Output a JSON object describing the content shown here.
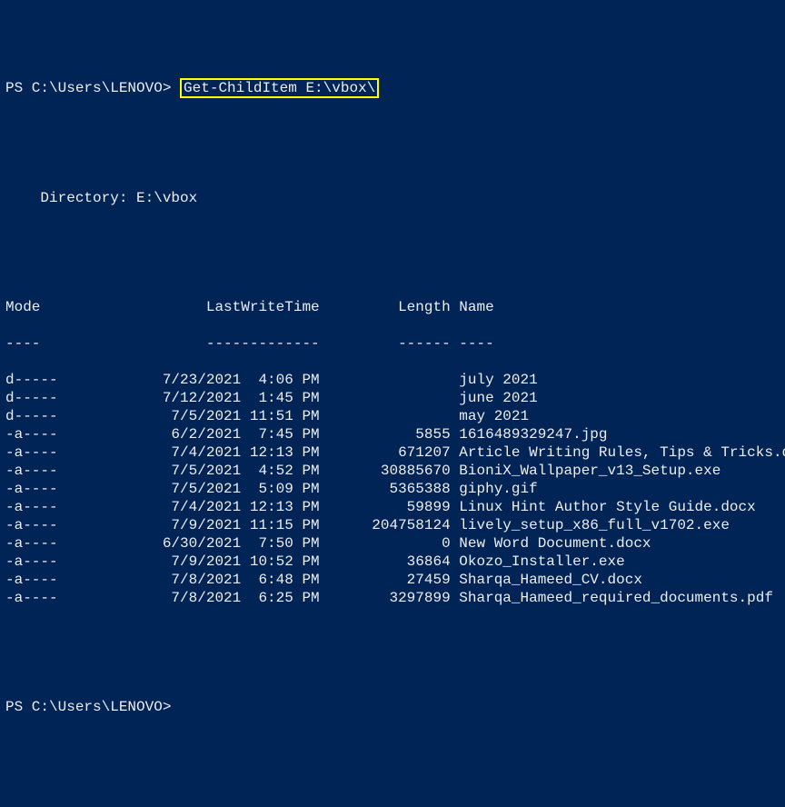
{
  "prompt1": {
    "prefix": "PS C:\\Users\\LENOVO> ",
    "command": "Get-ChildItem E:\\vbox\\"
  },
  "directory_label": "    Directory: E:\\vbox",
  "headers": {
    "mode": "Mode",
    "lwt": "LastWriteTime",
    "length": "Length",
    "name": "Name"
  },
  "underlines": {
    "mode": "----",
    "lwt": "-------------",
    "length": "------",
    "name": "----"
  },
  "rows": [
    {
      "mode": "d-----",
      "date": "7/23/2021",
      "time": "4:06 PM",
      "length": "",
      "name": "july 2021"
    },
    {
      "mode": "d-----",
      "date": "7/12/2021",
      "time": "1:45 PM",
      "length": "",
      "name": "june 2021"
    },
    {
      "mode": "d-----",
      "date": "7/5/2021",
      "time": "11:51 PM",
      "length": "",
      "name": "may 2021"
    },
    {
      "mode": "-a----",
      "date": "6/2/2021",
      "time": "7:45 PM",
      "length": "5855",
      "name": "1616489329247.jpg"
    },
    {
      "mode": "-a----",
      "date": "7/4/2021",
      "time": "12:13 PM",
      "length": "671207",
      "name": "Article Writing Rules, Tips & Tricks.docx"
    },
    {
      "mode": "-a----",
      "date": "7/5/2021",
      "time": "4:52 PM",
      "length": "30885670",
      "name": "BioniX_Wallpaper_v13_Setup.exe"
    },
    {
      "mode": "-a----",
      "date": "7/5/2021",
      "time": "5:09 PM",
      "length": "5365388",
      "name": "giphy.gif"
    },
    {
      "mode": "-a----",
      "date": "7/4/2021",
      "time": "12:13 PM",
      "length": "59899",
      "name": "Linux Hint Author Style Guide.docx"
    },
    {
      "mode": "-a----",
      "date": "7/9/2021",
      "time": "11:15 PM",
      "length": "204758124",
      "name": "lively_setup_x86_full_v1702.exe"
    },
    {
      "mode": "-a----",
      "date": "6/30/2021",
      "time": "7:50 PM",
      "length": "0",
      "name": "New Word Document.docx"
    },
    {
      "mode": "-a----",
      "date": "7/9/2021",
      "time": "10:52 PM",
      "length": "36864",
      "name": "Okozo_Installer.exe"
    },
    {
      "mode": "-a----",
      "date": "7/8/2021",
      "time": "6:48 PM",
      "length": "27459",
      "name": "Sharqa_Hameed_CV.docx"
    },
    {
      "mode": "-a----",
      "date": "7/8/2021",
      "time": "6:25 PM",
      "length": "3297899",
      "name": "Sharqa_Hameed_required_documents.pdf"
    }
  ],
  "prompt2": "PS C:\\Users\\LENOVO> "
}
